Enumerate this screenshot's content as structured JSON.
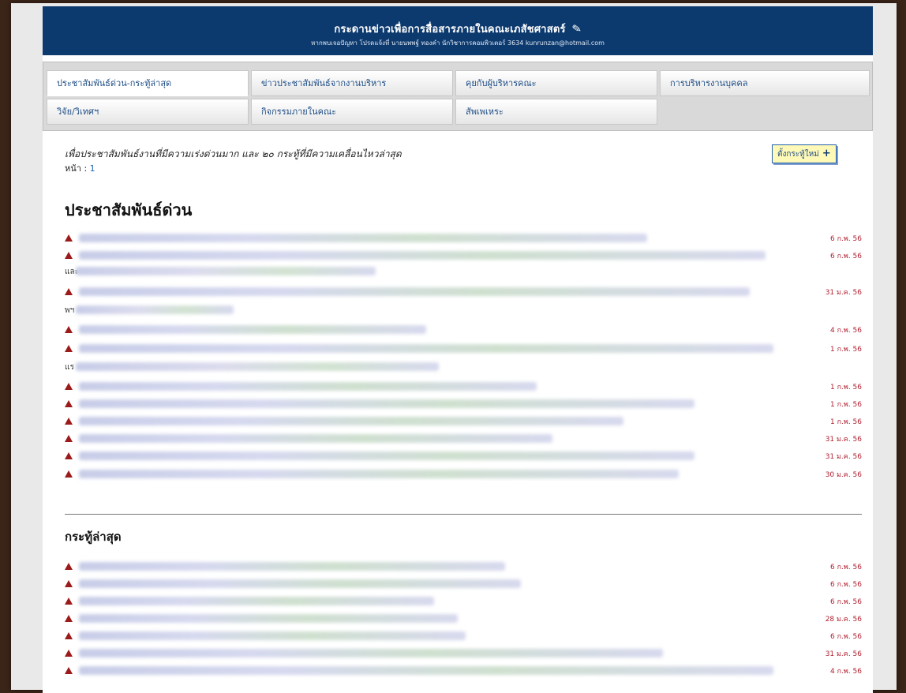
{
  "header": {
    "title": "กระดานข่าวเพื่อการสื่อสารภายในคณะเภสัชศาสตร์",
    "subtitle": "หากพบเจอปัญหา โปรดแจ้งที่ นายนพพฐ์ ทองคำ นักวิชาการคอมพิวเตอร์ 3634 kunrunzan@hotmail.com"
  },
  "tabs": [
    {
      "label": "ประชาสัมพันธ์ด่วน-กระทู้ล่าสุด"
    },
    {
      "label": "ข่าวประชาสัมพันธ์จากงานบริหาร"
    },
    {
      "label": "คุยกับผู้บริหารคณะ"
    },
    {
      "label": "การบริหารงานบุคคล"
    },
    {
      "label": "วิจัย/วิเทศฯ"
    },
    {
      "label": "กิจกรรมภายในคณะ"
    },
    {
      "label": "สัพเพเหระ"
    }
  ],
  "content": {
    "lead": "เพื่อประชาสัมพันธ์งานที่มีความเร่งด่วนมาก และ ๒๐ กระทู้ที่มีความเคลื่อนไหวล่าสุด",
    "page_label": "หน้า :",
    "page_number": "1",
    "new_topic_button": "ตั้งกระทู้ใหม่",
    "urgent_heading": "ประชาสัมพันธ์ด่วน",
    "latest_heading": "กระทู้ล่าสุด"
  },
  "urgent_items": [
    {
      "date": "6 ก.พ. 56"
    },
    {
      "date": "6 ก.พ. 56",
      "cont": "และ"
    },
    {
      "date": "31 ม.ค. 56",
      "cont": "พฯ"
    },
    {
      "date": "4 ก.พ. 56"
    },
    {
      "date": "1 ก.พ. 56",
      "cont": "แร"
    },
    {
      "date": "1 ก.พ. 56"
    },
    {
      "date": "1 ก.พ. 56"
    },
    {
      "date": "1 ก.พ. 56"
    },
    {
      "date": "31 ม.ค. 56"
    },
    {
      "date": "31 ม.ค. 56"
    },
    {
      "date": "30 ม.ค. 56"
    }
  ],
  "latest_items": [
    {
      "date": "6 ก.พ. 56"
    },
    {
      "date": "6 ก.พ. 56"
    },
    {
      "date": "6 ก.พ. 56"
    },
    {
      "date": "28 ม.ค. 56"
    },
    {
      "date": "6 ก.พ. 56"
    },
    {
      "date": "31 ม.ค. 56"
    },
    {
      "date": "4 ก.พ. 56"
    }
  ]
}
